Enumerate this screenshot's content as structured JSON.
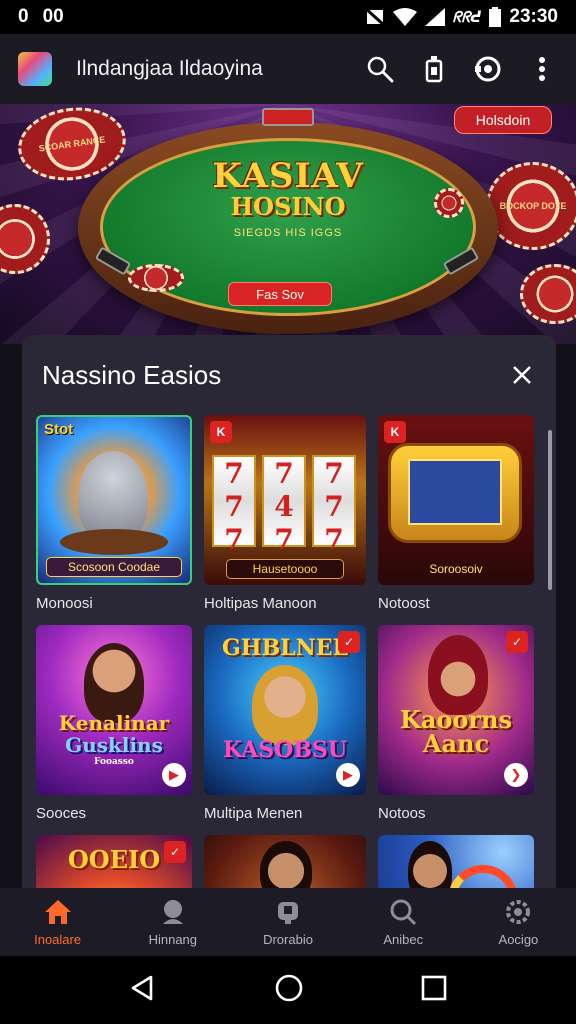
{
  "status_bar": {
    "left_icons": [
      "0",
      "00"
    ],
    "carrier": "ᖇᖇᕍ",
    "time": "23:30"
  },
  "app": {
    "title": "Ilndangjaa Ildaoyina"
  },
  "hero": {
    "logo_line1": "KASIAV",
    "logo_line2": "HOSINO",
    "logo_line3": "SIEGDS HIS IGGS",
    "play_button": "Fas Sov",
    "tag_button": "Holsdoin",
    "chip_text_left": "SCOAR RANCE",
    "chip_text_right": "BOCKOP DOTE"
  },
  "panel": {
    "title": "Nassino Easios",
    "cards": [
      {
        "label": "Monoosi",
        "thumb_badge": "Stot",
        "thumb_caption": "Scosoon Coodae"
      },
      {
        "label": "Holtipas Manoon",
        "corner": "K",
        "thumb_caption": "Hausetoooo"
      },
      {
        "label": "Notoost",
        "corner": "K",
        "thumb_caption": "Soroosoiv"
      },
      {
        "label": "Sooces",
        "title1": "Kenalinar",
        "title2": "Gusklins",
        "sub": "Fooasso"
      },
      {
        "label": "Multipa Menen",
        "title1": "GHBLNEL",
        "title2": "KASOBSU"
      },
      {
        "label": "Notoos",
        "title1": "Kaoorns",
        "title2": "Aanc"
      },
      {
        "label": "",
        "title1": "OOEIO"
      },
      {
        "label": ""
      },
      {
        "label": ""
      }
    ]
  },
  "bottom_nav": [
    {
      "label": "Inoalare",
      "icon": "home-icon",
      "active": true
    },
    {
      "label": "Hinnang",
      "icon": "person-icon"
    },
    {
      "label": "Drorabio",
      "icon": "gamepad-icon"
    },
    {
      "label": "Anibec",
      "icon": "search-icon"
    },
    {
      "label": "Aocigo",
      "icon": "settings-icon"
    }
  ],
  "colors": {
    "accent": "#ff6a2a",
    "panel": "#2a2836",
    "appbar": "#1c1b24"
  }
}
